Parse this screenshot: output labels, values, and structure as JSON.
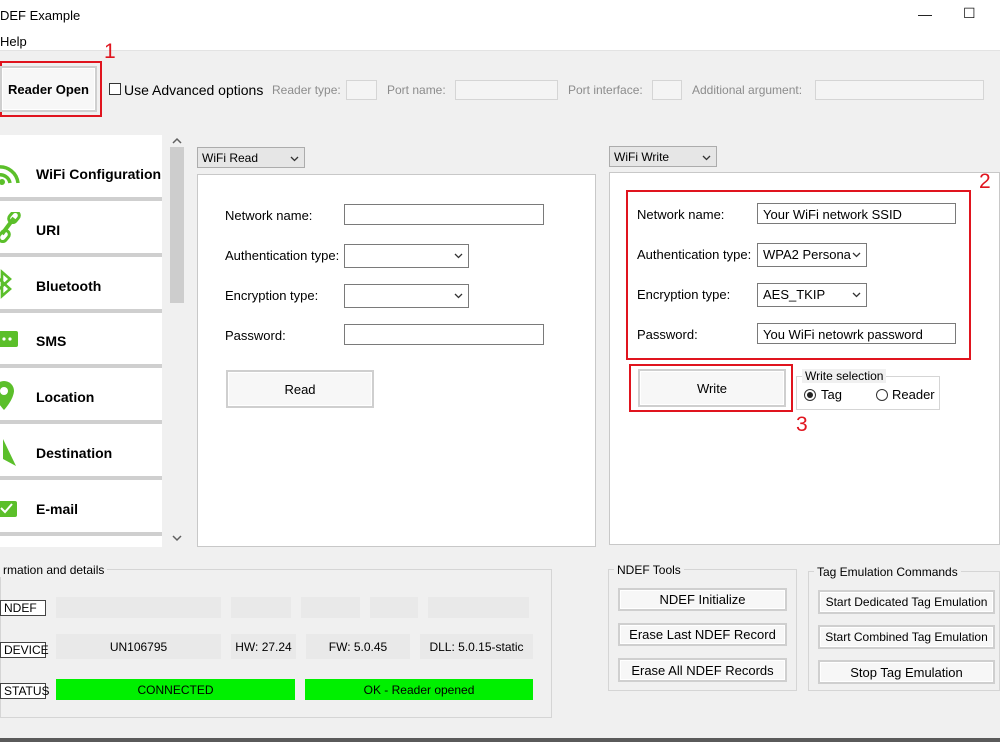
{
  "window": {
    "title": "DEF Example",
    "minimize": "—",
    "maximize": "☐"
  },
  "menu": {
    "help": "Help"
  },
  "toolbar": {
    "reader_open": "Reader Open",
    "advanced_options": "Use Advanced options",
    "reader_type": "Reader type:",
    "port_name": "Port name:",
    "port_interface": "Port interface:",
    "additional_argument": "Additional argument:"
  },
  "annotations": {
    "n1": "1",
    "n2": "2",
    "n3": "3"
  },
  "sidebar": {
    "items": [
      {
        "label": "WiFi Configuration",
        "icon": "wifi-icon"
      },
      {
        "label": "URI",
        "icon": "link-icon"
      },
      {
        "label": "Bluetooth",
        "icon": "bluetooth-icon"
      },
      {
        "label": "SMS",
        "icon": "sms-icon"
      },
      {
        "label": "Location",
        "icon": "location-icon"
      },
      {
        "label": "Destination",
        "icon": "navigation-icon"
      },
      {
        "label": "E-mail",
        "icon": "email-icon"
      }
    ],
    "scroll_down": "⌄"
  },
  "read_panel": {
    "mode": "WiFi Read",
    "network_name_label": "Network name:",
    "auth_type_label": "Authentication type:",
    "encryption_type_label": "Encryption type:",
    "password_label": "Password:",
    "read_button": "Read"
  },
  "write_panel": {
    "mode": "WiFi Write",
    "network_name_label": "Network name:",
    "network_name_value": "Your WiFi network SSID",
    "auth_type_label": "Authentication type:",
    "auth_type_value": "WPA2 Persona",
    "encryption_type_label": "Encryption type:",
    "encryption_type_value": "AES_TKIP",
    "password_label": "Password:",
    "password_value": "You WiFi netowrk password",
    "write_button": "Write",
    "write_selection_title": "Write selection",
    "option_tag": "Tag",
    "option_reader": "Reader"
  },
  "info": {
    "title": "rmation and details",
    "ndef_label": "NDEF",
    "device_label": "DEVICE",
    "status_label": "STATUS",
    "device_uid": "UN106795",
    "hw": "HW: 27.24",
    "fw": "FW: 5.0.45",
    "dll": "DLL: 5.0.15-static",
    "connection": "CONNECTED",
    "reader_status": "OK -  Reader opened"
  },
  "ndef_tools": {
    "title": "NDEF Tools",
    "initialize": "NDEF Initialize",
    "erase_last": "Erase Last NDEF Record",
    "erase_all": "Erase All NDEF Records"
  },
  "tag_emulation": {
    "title": "Tag Emulation Commands",
    "start_dedicated": "Start Dedicated Tag Emulation",
    "start_combined": "Start Combined Tag Emulation",
    "stop": "Stop Tag Emulation"
  },
  "colors": {
    "accent_red": "#e0141e",
    "status_green": "#00f000",
    "icon_green": "#5bbf2a"
  }
}
